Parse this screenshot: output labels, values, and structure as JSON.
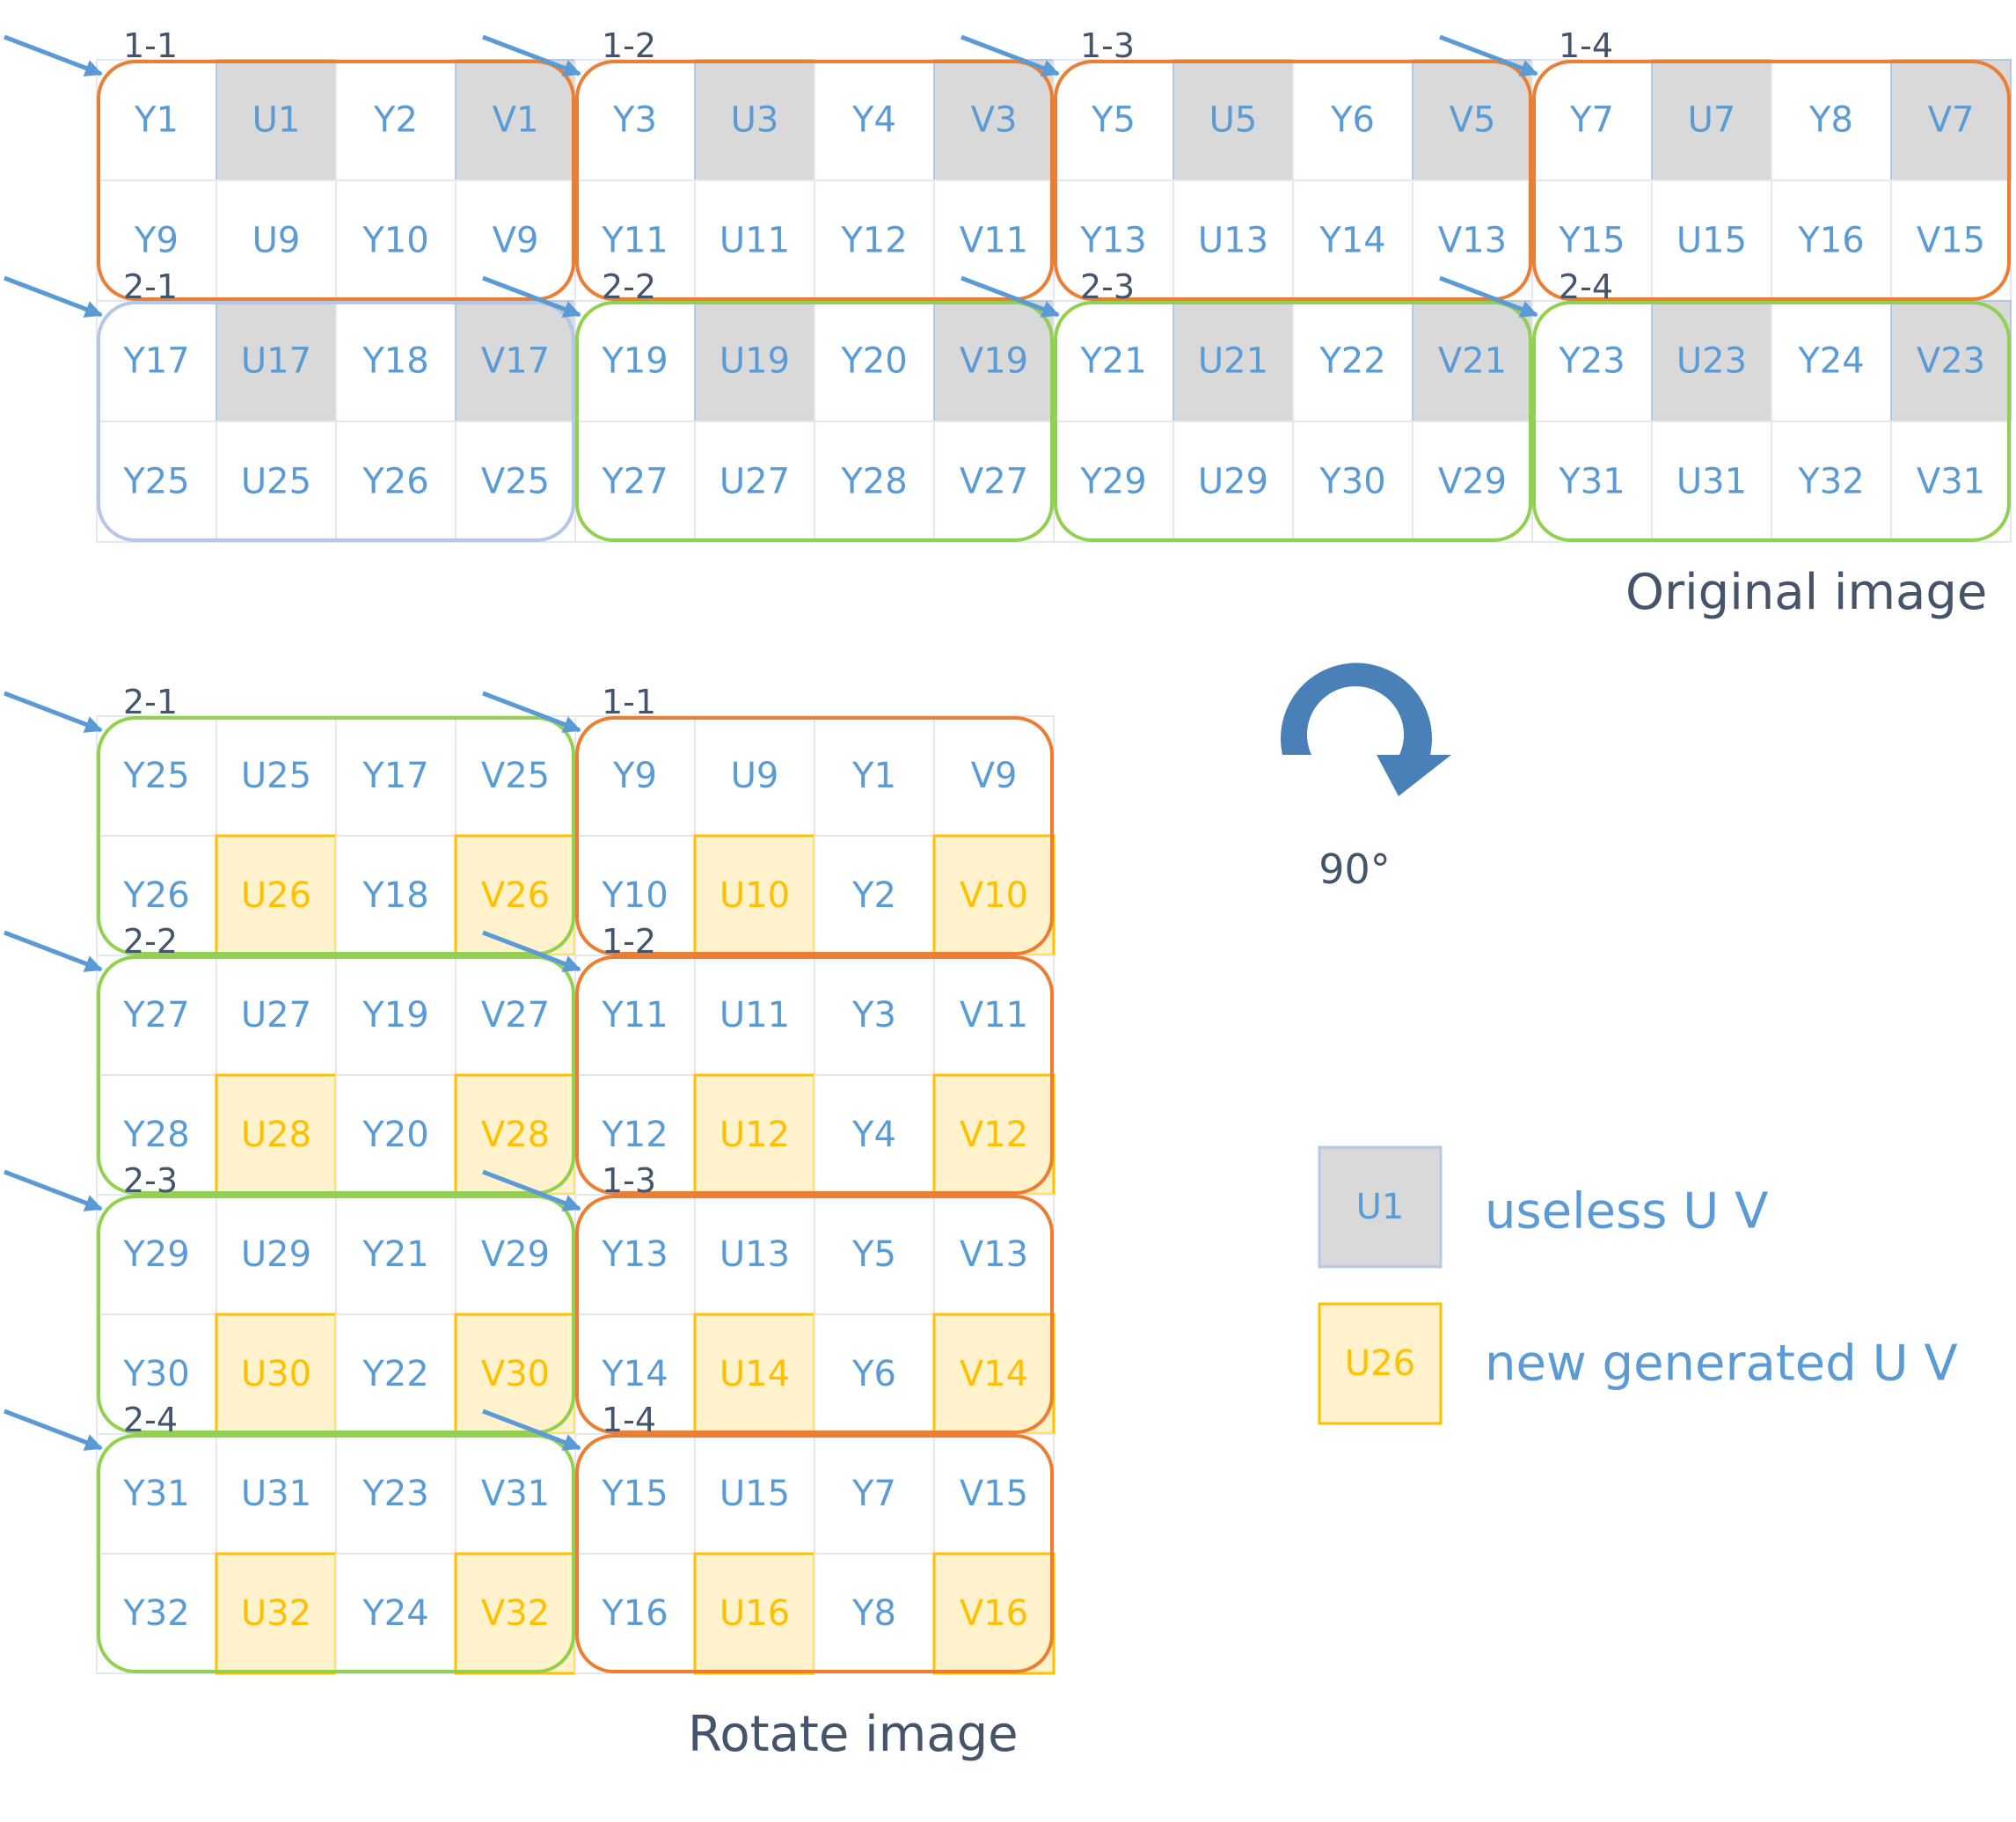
{
  "colors": {
    "text_blue": "#5b9bd5",
    "gray_fill": "#d9d9d9",
    "gray_stroke": "#b4c7e7",
    "yellow_fill": "#fff2cc",
    "yellow_stroke": "#ffc000",
    "yellow_text": "#ffc000",
    "grid_line": "#e3e8f0",
    "orange_group": "#ed7d31",
    "green_group": "#92d050",
    "lightblue_group": "#b4c7e7",
    "arrow": "#5b9bd5",
    "rotate_arrow": "#4a80b8",
    "label_dark": "#44546a"
  },
  "original": {
    "caption": "Original image",
    "rows": [
      [
        "Y1",
        "U1",
        "Y2",
        "V1",
        "Y3",
        "U3",
        "Y4",
        "V3",
        "Y5",
        "U5",
        "Y6",
        "V5",
        "Y7",
        "U7",
        "Y8",
        "V7"
      ],
      [
        "Y9",
        "U9",
        "Y10",
        "V9",
        "Y11",
        "U11",
        "Y12",
        "V11",
        "Y13",
        "U13",
        "Y14",
        "V13",
        "Y15",
        "U15",
        "Y16",
        "V15"
      ],
      [
        "Y17",
        "U17",
        "Y18",
        "V17",
        "Y19",
        "U19",
        "Y20",
        "V19",
        "Y21",
        "U21",
        "Y22",
        "V21",
        "Y23",
        "U23",
        "Y24",
        "V23"
      ],
      [
        "Y25",
        "U25",
        "Y26",
        "V25",
        "Y27",
        "U27",
        "Y28",
        "V27",
        "Y29",
        "U29",
        "Y30",
        "V29",
        "Y31",
        "U31",
        "Y32",
        "V31"
      ]
    ],
    "gray_cells": [
      [
        0,
        1
      ],
      [
        0,
        3
      ],
      [
        0,
        5
      ],
      [
        0,
        7
      ],
      [
        0,
        9
      ],
      [
        0,
        11
      ],
      [
        0,
        13
      ],
      [
        0,
        15
      ],
      [
        2,
        1
      ],
      [
        2,
        3
      ],
      [
        2,
        5
      ],
      [
        2,
        7
      ],
      [
        2,
        9
      ],
      [
        2,
        11
      ],
      [
        2,
        13
      ],
      [
        2,
        15
      ]
    ],
    "groups": [
      {
        "label": "1-1",
        "row": 0,
        "col": 0,
        "color": "orange"
      },
      {
        "label": "1-2",
        "row": 0,
        "col": 4,
        "color": "orange"
      },
      {
        "label": "1-3",
        "row": 0,
        "col": 8,
        "color": "orange"
      },
      {
        "label": "1-4",
        "row": 0,
        "col": 12,
        "color": "orange"
      },
      {
        "label": "2-1",
        "row": 2,
        "col": 0,
        "color": "lightblue"
      },
      {
        "label": "2-2",
        "row": 2,
        "col": 4,
        "color": "green"
      },
      {
        "label": "2-3",
        "row": 2,
        "col": 8,
        "color": "green"
      },
      {
        "label": "2-4",
        "row": 2,
        "col": 12,
        "color": "green"
      }
    ]
  },
  "rotated": {
    "caption": "Rotate image",
    "rows": [
      [
        "Y25",
        "U25",
        "Y17",
        "V25",
        "Y9",
        "U9",
        "Y1",
        "V9"
      ],
      [
        "Y26",
        "U26",
        "Y18",
        "V26",
        "Y10",
        "U10",
        "Y2",
        "V10"
      ],
      [
        "Y27",
        "U27",
        "Y19",
        "V27",
        "Y11",
        "U11",
        "Y3",
        "V11"
      ],
      [
        "Y28",
        "U28",
        "Y20",
        "V28",
        "Y12",
        "U12",
        "Y4",
        "V12"
      ],
      [
        "Y29",
        "U29",
        "Y21",
        "V29",
        "Y13",
        "U13",
        "Y5",
        "V13"
      ],
      [
        "Y30",
        "U30",
        "Y22",
        "V30",
        "Y14",
        "U14",
        "Y6",
        "V14"
      ],
      [
        "Y31",
        "U31",
        "Y23",
        "V31",
        "Y15",
        "U15",
        "Y7",
        "V15"
      ],
      [
        "Y32",
        "U32",
        "Y24",
        "V32",
        "Y16",
        "U16",
        "Y8",
        "V16"
      ]
    ],
    "yellow_cells": [
      [
        1,
        1
      ],
      [
        1,
        3
      ],
      [
        1,
        5
      ],
      [
        1,
        7
      ],
      [
        3,
        1
      ],
      [
        3,
        3
      ],
      [
        3,
        5
      ],
      [
        3,
        7
      ],
      [
        5,
        1
      ],
      [
        5,
        3
      ],
      [
        5,
        5
      ],
      [
        5,
        7
      ],
      [
        7,
        1
      ],
      [
        7,
        3
      ],
      [
        7,
        5
      ],
      [
        7,
        7
      ]
    ],
    "groups": [
      {
        "label": "2-1",
        "row": 0,
        "col": 0,
        "color": "green"
      },
      {
        "label": "1-1",
        "row": 0,
        "col": 4,
        "color": "orange"
      },
      {
        "label": "2-2",
        "row": 2,
        "col": 0,
        "color": "green"
      },
      {
        "label": "1-2",
        "row": 2,
        "col": 4,
        "color": "orange"
      },
      {
        "label": "2-3",
        "row": 4,
        "col": 0,
        "color": "green"
      },
      {
        "label": "1-3",
        "row": 4,
        "col": 4,
        "color": "orange"
      },
      {
        "label": "2-4",
        "row": 6,
        "col": 0,
        "color": "green"
      },
      {
        "label": "1-4",
        "row": 6,
        "col": 4,
        "color": "orange"
      }
    ]
  },
  "rotation": {
    "angle_label": "90°"
  },
  "legend": {
    "items": [
      {
        "swatch_text": "U1",
        "text": "useless U V",
        "style": "gray"
      },
      {
        "swatch_text": "U26",
        "text": "new generated U V",
        "style": "yellow"
      }
    ]
  }
}
